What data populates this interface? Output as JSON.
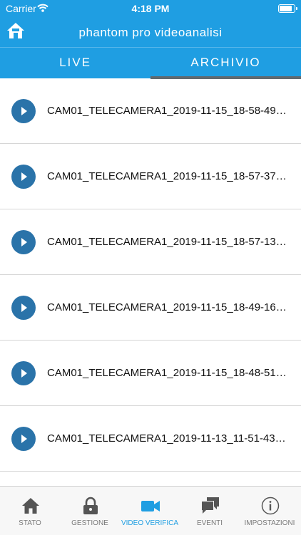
{
  "status_bar": {
    "carrier": "Carrier",
    "time": "4:18 PM",
    "battery_level": 0.95
  },
  "header": {
    "title": "phantom pro videoanalisi"
  },
  "tabs": [
    {
      "label": "LIVE",
      "active": false
    },
    {
      "label": "ARCHIVIO",
      "active": true
    }
  ],
  "recordings": [
    {
      "name": "CAM01_TELECAMERA1_2019-11-15_18-58-49_..."
    },
    {
      "name": "CAM01_TELECAMERA1_2019-11-15_18-57-37_..."
    },
    {
      "name": "CAM01_TELECAMERA1_2019-11-15_18-57-13_..."
    },
    {
      "name": "CAM01_TELECAMERA1_2019-11-15_18-49-16_..."
    },
    {
      "name": "CAM01_TELECAMERA1_2019-11-15_18-48-51_..."
    },
    {
      "name": "CAM01_TELECAMERA1_2019-11-13_11-51-43_..."
    }
  ],
  "tabbar": [
    {
      "label": "STATO",
      "icon": "home-icon"
    },
    {
      "label": "GESTIONE",
      "icon": "lock-icon"
    },
    {
      "label": "VIDEO VERIFICA",
      "icon": "video-camera-icon",
      "active": true
    },
    {
      "label": "EVENTI",
      "icon": "chat-bubbles-icon"
    },
    {
      "label": "IMPOSTAZIONI",
      "icon": "info-icon"
    }
  ],
  "colors": {
    "primary": "#1f9ee2",
    "play_button": "#2a73a9",
    "tab_indicator": "#606a70",
    "inactive": "#555555"
  }
}
